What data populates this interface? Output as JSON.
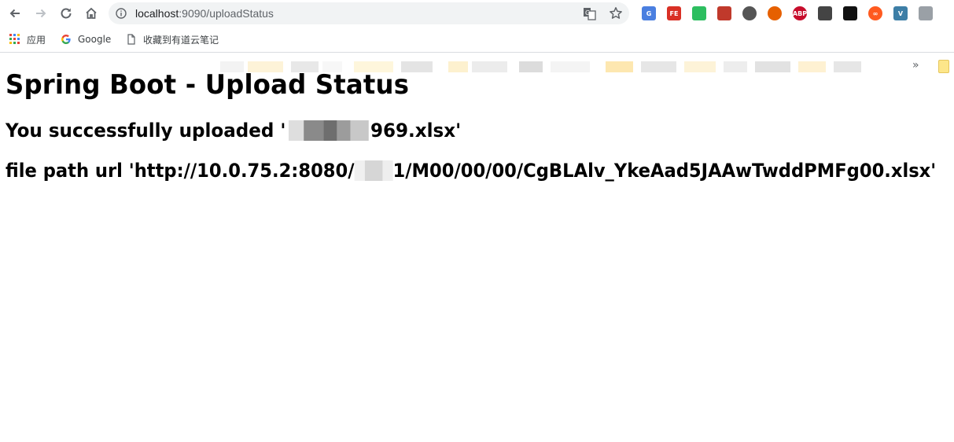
{
  "browser": {
    "url_host": "localhost",
    "url_rest": ":9090/uploadStatus",
    "bookmarks": [
      {
        "label": "应用",
        "icon": "apps-grid-icon"
      },
      {
        "label": "Google",
        "icon": "google-g-icon"
      },
      {
        "label": "收藏到有道云笔记",
        "icon": "page-icon"
      }
    ],
    "extensions": [
      {
        "name": "google-translate-ext-icon",
        "text": "G",
        "color": "#4a7fe0"
      },
      {
        "name": "fe-helper-ext-icon",
        "text": "FE",
        "color": "#d93025"
      },
      {
        "name": "evernote-ext-icon",
        "text": "",
        "color": "#2dbe60"
      },
      {
        "name": "red-ext-icon",
        "text": "",
        "color": "#c0392b"
      },
      {
        "name": "pen-ext-icon",
        "text": "",
        "color": "#555555"
      },
      {
        "name": "firefox-ext-icon",
        "text": "",
        "color": "#e66000"
      },
      {
        "name": "adblock-plus-ext-icon",
        "text": "ABP",
        "color": "#c70d2c"
      },
      {
        "name": "dark-ext-icon",
        "text": "",
        "color": "#444444"
      },
      {
        "name": "mask-ext-icon",
        "text": "",
        "color": "#111111"
      },
      {
        "name": "infinity-ext-icon",
        "text": "∞",
        "color": "#ff5a1f"
      },
      {
        "name": "vue-ext-icon",
        "text": "V",
        "color": "#3d7ea6"
      },
      {
        "name": "bird-ext-icon",
        "text": "",
        "color": "#9aa0a6"
      }
    ]
  },
  "page": {
    "title": "Spring Boot - Upload Status",
    "message_prefix": "You successfully uploaded '",
    "message_suffix": "969.xlsx'",
    "path_prefix": "file path url 'http://10.0.75.2:8080/",
    "path_suffix": "1/M00/00/00/CgBLAlv_YkeAad5JAAwTwddPMFg00.xlsx'"
  }
}
